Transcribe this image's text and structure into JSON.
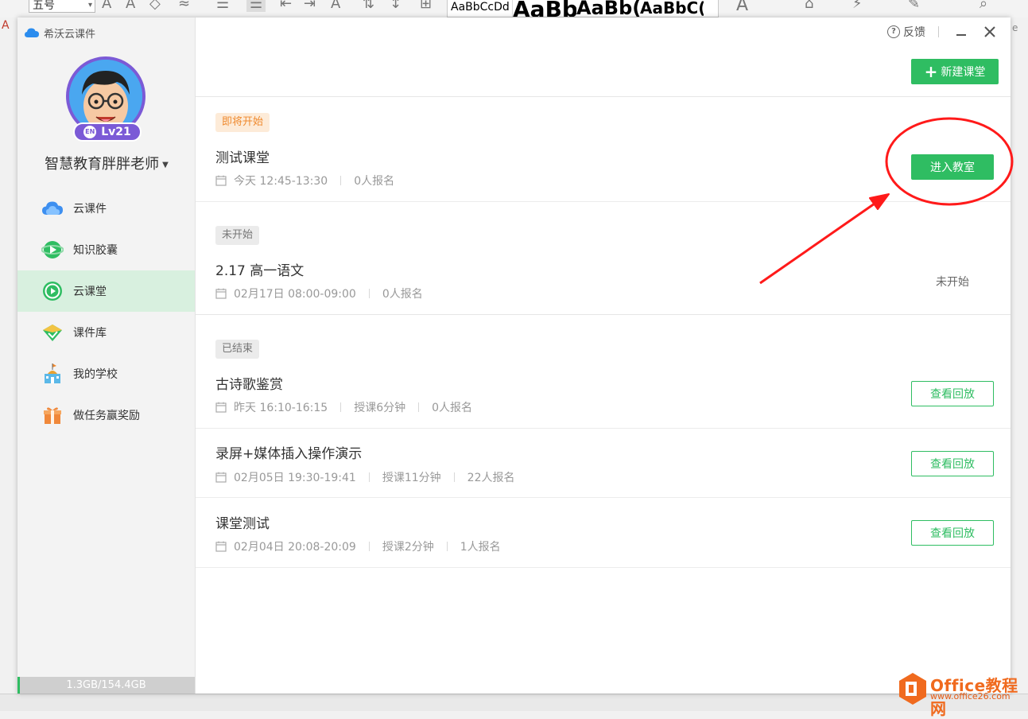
{
  "background_app": {
    "font_size_value": "五号",
    "style_samples": [
      "AaBbCcDd",
      "AaBb",
      "AaBb(",
      "AaBbC("
    ],
    "left_strip_letter": "A",
    "right_strip_letter": "e"
  },
  "app": {
    "title": "希沃云课件",
    "user": {
      "name": "智慧教育胖胖老师",
      "level": "Lv21",
      "level_badge_icon_text": "EN"
    },
    "nav": [
      {
        "label": "云课件",
        "icon": "cloud-icon",
        "active": false
      },
      {
        "label": "知识胶囊",
        "icon": "capsule-play-icon",
        "active": false
      },
      {
        "label": "云课堂",
        "icon": "classroom-play-icon",
        "active": true
      },
      {
        "label": "课件库",
        "icon": "courseware-library-icon",
        "active": false
      },
      {
        "label": "我的学校",
        "icon": "school-icon",
        "active": false
      },
      {
        "label": "做任务赢奖励",
        "icon": "gift-icon",
        "active": false
      }
    ],
    "storage": "1.3GB/154.4GB"
  },
  "header": {
    "feedback_label": "反馈",
    "new_class_label": "新建课堂"
  },
  "classes": [
    {
      "status_tag": "即将开始",
      "title": "测试课堂",
      "time": "今天 12:45-13:30",
      "signups": "0人报名",
      "action_label": "进入教室"
    },
    {
      "status_tag": "未开始",
      "title": "2.17 高一语文",
      "time": "02月17日 08:00-09:00",
      "signups": "0人报名",
      "status_text": "未开始"
    },
    {
      "status_tag": "已结束",
      "title": "古诗歌鉴赏",
      "time": "昨天 16:10-16:15",
      "duration": "授课6分钟",
      "signups": "0人报名",
      "action_label": "查看回放"
    },
    {
      "title": "录屏+媒体插入操作演示",
      "time": "02月05日 19:30-19:41",
      "duration": "授课11分钟",
      "signups": "22人报名",
      "action_label": "查看回放"
    },
    {
      "title": "课堂测试",
      "time": "02月04日 20:08-20:09",
      "duration": "授课2分钟",
      "signups": "1人报名",
      "action_label": "查看回放"
    }
  ],
  "watermark": {
    "brand": "Office教程网",
    "url": "www.office26.com"
  },
  "colors": {
    "accent_green": "#2fbd62",
    "tag_orange": "#ef8a2f",
    "annotation_red": "#ff1a1a",
    "avatar_purple": "#7b5ad6"
  }
}
